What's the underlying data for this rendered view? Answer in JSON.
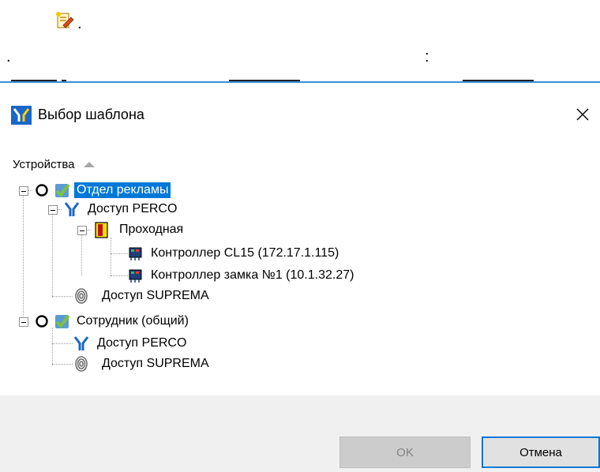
{
  "doc": {
    "period_top": ".",
    "period_left": ".",
    "colon": ":"
  },
  "dialog": {
    "title": "Выбор шаблона",
    "close_glyph": "✕",
    "sort_column": "Устройства",
    "tree": {
      "group1": {
        "label": "Отдел рекламы",
        "access_perco": "Доступ PERCO",
        "checkpoint": "Проходная",
        "controller1": "Контроллер CL15 (172.17.1.115)",
        "controller2": "Контроллер замка №1 (10.1.32.27)",
        "access_suprema": "Доступ SUPREMA"
      },
      "group2": {
        "label": "Сотрудник (общий)",
        "access_perco": "Доступ PERCO",
        "access_suprema": "Доступ SUPREMA"
      }
    },
    "buttons": {
      "ok": "OK",
      "cancel": "Отмена"
    }
  },
  "colors": {
    "selection": "#0078d7",
    "accent_line": "#3c8ed6",
    "footer": "#f0f0f0"
  }
}
